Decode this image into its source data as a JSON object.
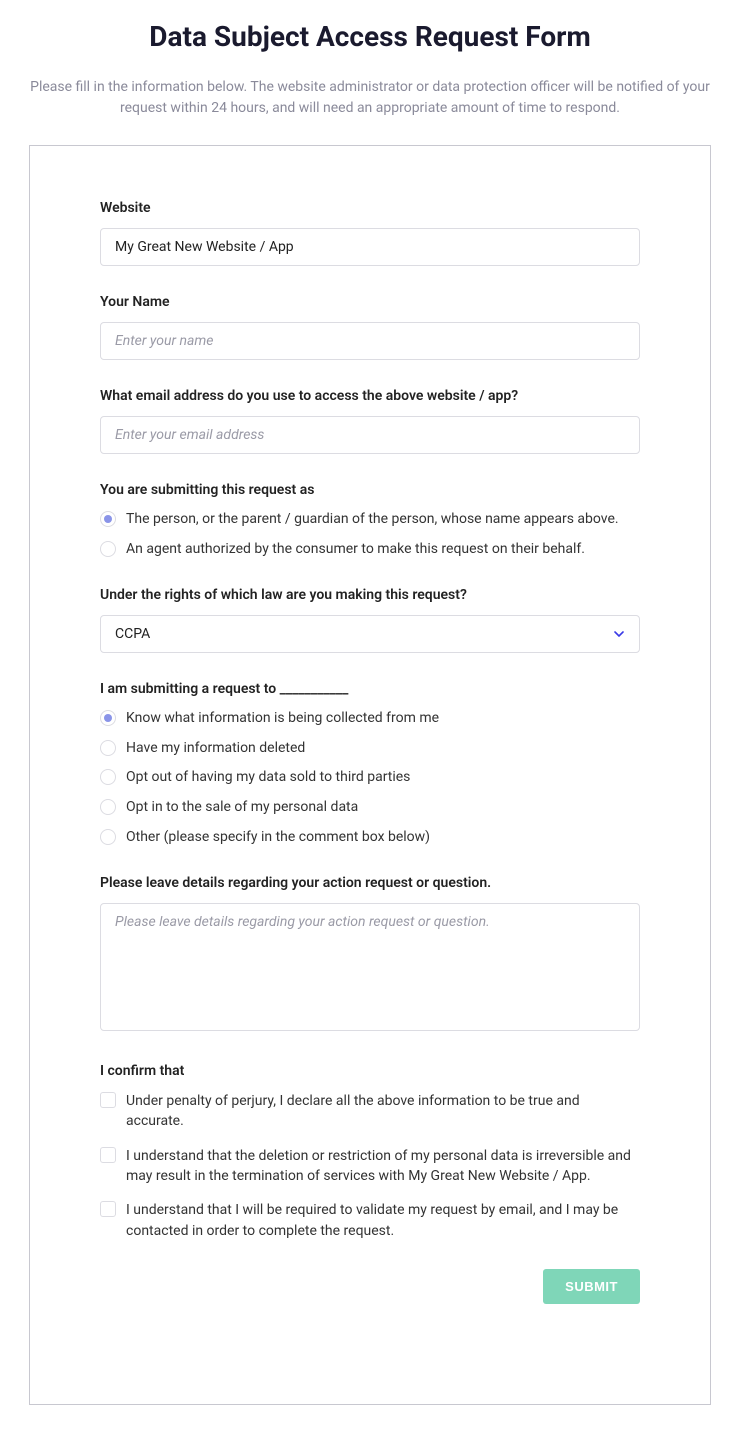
{
  "title": "Data Subject Access Request Form",
  "subtitle": "Please fill in the information below. The website administrator or data protection officer will be notified of your request within 24 hours, and will need an appropriate amount of time to respond.",
  "website": {
    "label": "Website",
    "value": "My Great New Website / App"
  },
  "name": {
    "label": "Your Name",
    "placeholder": "Enter your name",
    "value": ""
  },
  "email": {
    "label": "What email address do you use to access the above website / app?",
    "placeholder": "Enter your email address",
    "value": ""
  },
  "submitting_as": {
    "label": "You are submitting this request as",
    "options": [
      "The person, or the parent / guardian of the person, whose name appears above.",
      "An agent authorized by the consumer to make this request on their behalf."
    ],
    "selected": 0
  },
  "law": {
    "label": "Under the rights of which law are you making this request?",
    "selected": "CCPA"
  },
  "request_to": {
    "label": "I am submitting a request to ___________",
    "options": [
      "Know what information is being collected from me",
      "Have my information deleted",
      "Opt out of having my data sold to third parties",
      "Opt in to the sale of my personal data",
      "Other (please specify in the comment box below)"
    ],
    "selected": 0
  },
  "details": {
    "label": "Please leave details regarding your action request or question.",
    "placeholder": "Please leave details regarding your action request or question.",
    "value": ""
  },
  "confirm": {
    "label": "I confirm that",
    "items": [
      "Under penalty of perjury, I declare all the above information to be true and accurate.",
      "I understand that the deletion or restriction of my personal data is irreversible and may result in the termination of services with My Great New Website / App.",
      "I understand that I will be required to validate my request by email, and I may be contacted in order to complete the request."
    ]
  },
  "submit_label": "SUBMIT"
}
